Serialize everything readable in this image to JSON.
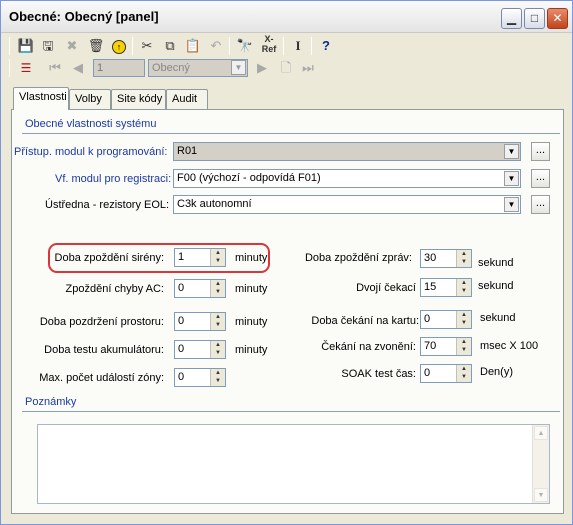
{
  "window": {
    "title": "Obecné:  Obecný [panel]",
    "minimize_icon": "minimize-icon",
    "maximize_icon": "maximize-icon",
    "close_icon": "close-icon"
  },
  "toolbar": {
    "icons": [
      "save-icon",
      "save-all-icon",
      "delete-icon",
      "trash-icon",
      "up-arrow-circle-icon",
      "cut-icon",
      "copy-icon",
      "paste-icon",
      "undo-icon",
      "find-icon",
      "x-ref-icon",
      "text-cursor-icon",
      "help-icon"
    ],
    "xref_label": "X-\nRef",
    "nav_icons": [
      "list-icon",
      "first-record-icon",
      "previous-record-icon",
      "next-record-icon",
      "new-record-icon",
      "last-record-icon"
    ],
    "record_number": "1",
    "record_name": "Obecný"
  },
  "tabs": [
    {
      "label": "Vlastnosti",
      "active": true
    },
    {
      "label": "Volby",
      "active": false
    },
    {
      "label": "Site kódy",
      "active": false
    },
    {
      "label": "Audit",
      "active": false
    }
  ],
  "properties": {
    "section_title": "Obecné vlastnosti systému",
    "access_module": {
      "label": "Přístup. modul k programování:",
      "value": "R01"
    },
    "rf_module": {
      "label": "Vf. modul pro registraci:",
      "value": "F00 (výchozí - odpovídá  F01)"
    },
    "eol": {
      "label": "Ústředna - rezistory EOL:",
      "value": "C3k autonomní"
    },
    "dots_label": "..."
  },
  "timers_left": [
    {
      "label": "Doba zpoždění sirény:",
      "value": "1",
      "unit": "minuty"
    },
    {
      "label": "Zpoždění chyby AC:",
      "value": "0",
      "unit": "minuty"
    },
    {
      "label": "Doba pozdržení prostoru:",
      "value": "0",
      "unit": "minuty"
    },
    {
      "label": "Doba testu akumulátoru:",
      "value": "0",
      "unit": "minuty"
    },
    {
      "label": "Max. počet událostí zóny:",
      "value": "0",
      "unit": ""
    }
  ],
  "timers_right": [
    {
      "label": "Doba zpoždění zpráv:",
      "value": "30",
      "unit": "sekund"
    },
    {
      "label": "Dvojí čekací",
      "value": "15",
      "unit": "sekund"
    },
    {
      "label": "Doba čekání na kartu:",
      "value": "0",
      "unit": "sekund"
    },
    {
      "label": "Čekání na zvonění:",
      "value": "70",
      "unit": "msec X 100"
    },
    {
      "label": "SOAK test čas:",
      "value": "0",
      "unit": "Den(y)"
    }
  ],
  "notes": {
    "title": "Poznámky",
    "value": ""
  },
  "colors": {
    "highlight": "#d8363b",
    "section": "#1b3aa6"
  }
}
